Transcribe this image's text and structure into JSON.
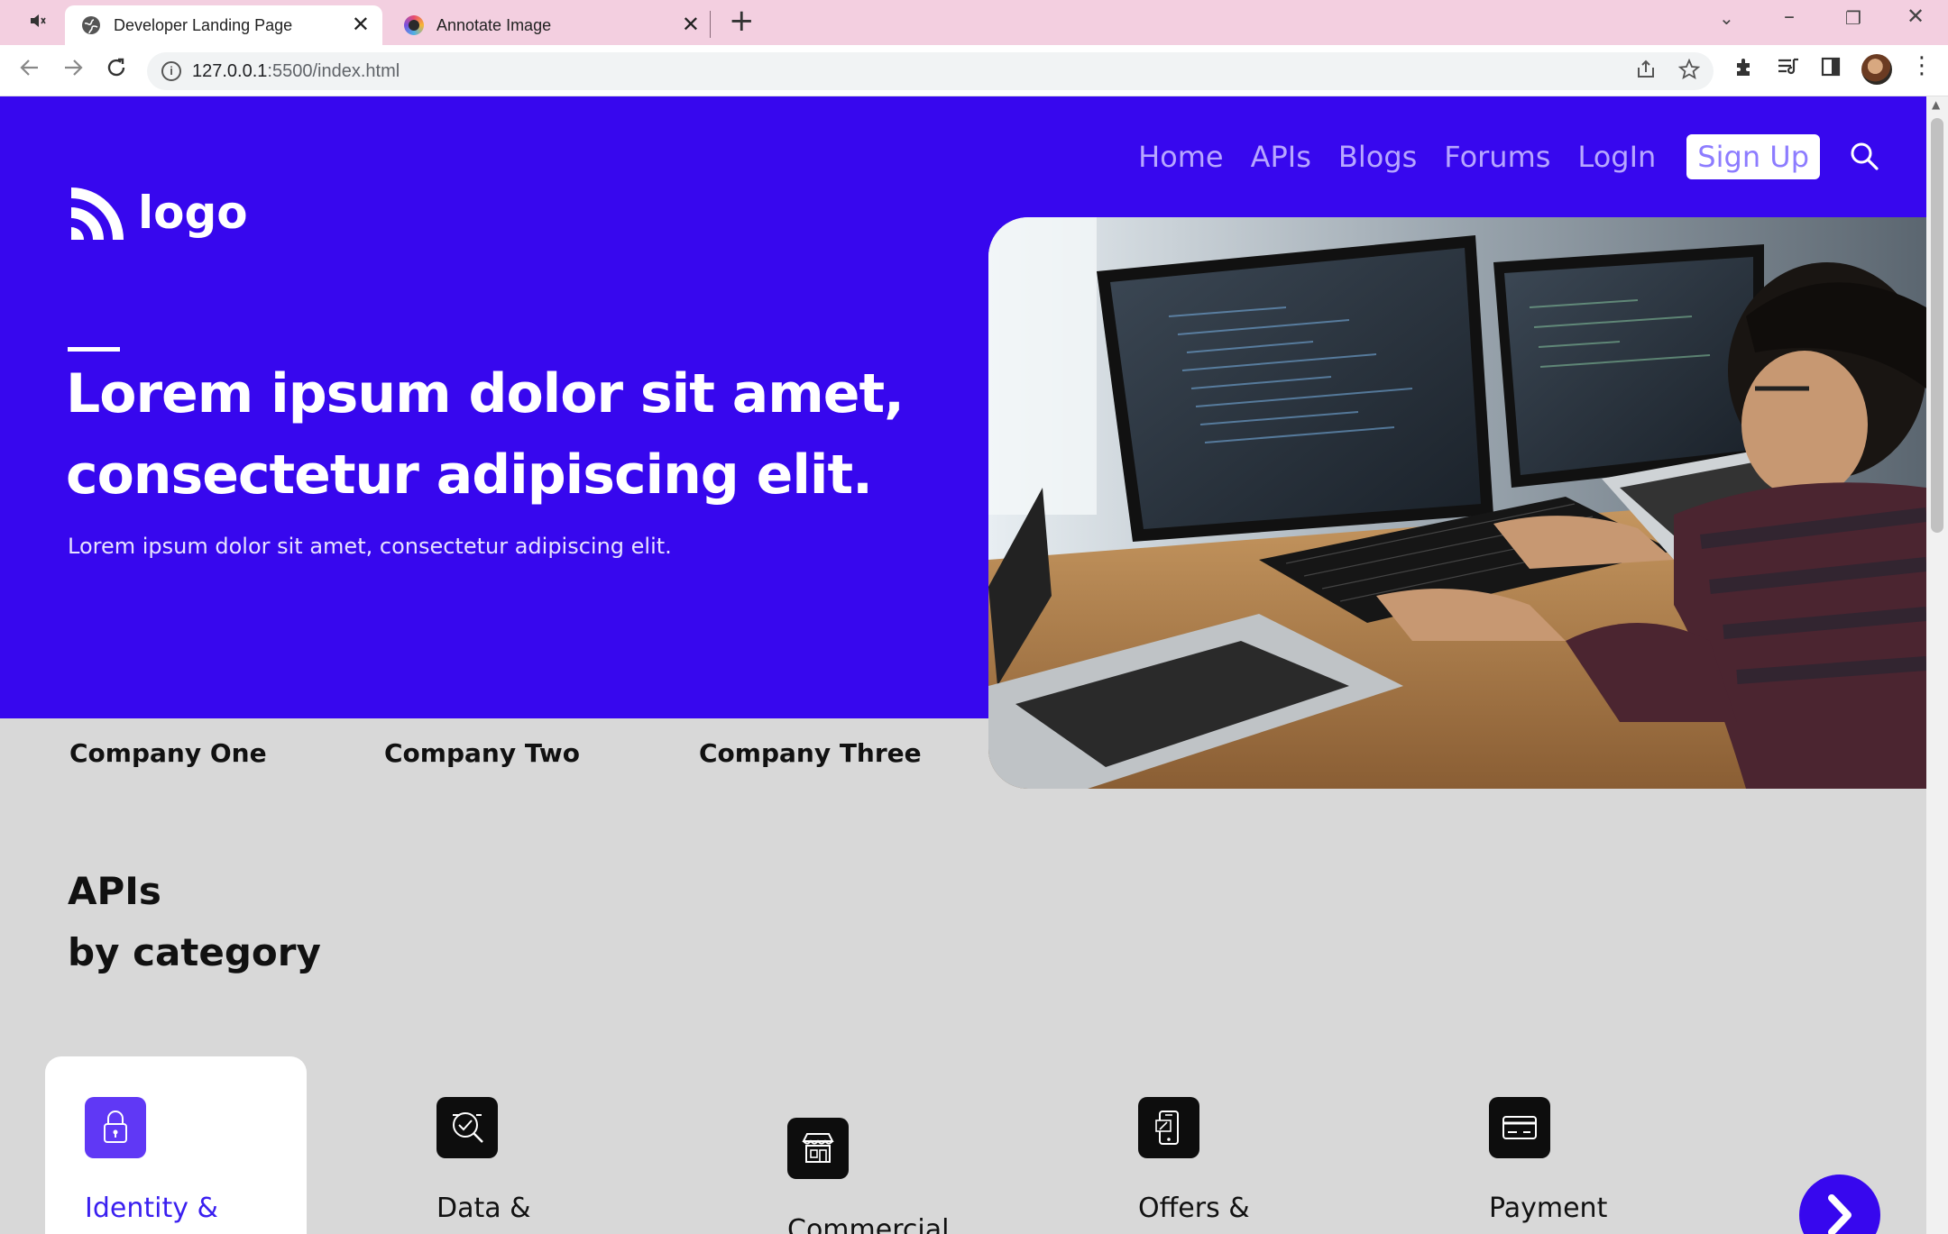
{
  "browser": {
    "tabs": [
      {
        "title": "Developer Landing Page",
        "active": true
      },
      {
        "title": "Annotate Image",
        "active": false
      }
    ],
    "new_tab_symbol": "+",
    "close_symbol": "✕",
    "url_host": "127.0.0.1",
    "url_path": ":5500/index.html",
    "info_symbol": "i"
  },
  "nav": {
    "items": [
      "Home",
      "APIs",
      "Blogs",
      "Forums",
      "LogIn"
    ],
    "signup": "Sign Up",
    "search_icon": "search-icon"
  },
  "logo": {
    "text": "logo"
  },
  "hero": {
    "title": "Lorem ipsum dolor sit amet, consectetur adipiscing elit.",
    "subtitle": "Lorem ipsum dolor sit amet, consectetur adipiscing elit."
  },
  "companies": [
    "Company One",
    "Company Two",
    "Company Three"
  ],
  "apis": {
    "title_line1": "APIs",
    "title_line2": "by category",
    "categories": [
      {
        "label": "Identity &",
        "icon": "lock-icon",
        "active": true
      },
      {
        "label": "Data &",
        "icon": "magnifier-check-icon",
        "active": false
      },
      {
        "label": "Commercial",
        "icon": "storefront-icon",
        "active": false
      },
      {
        "label": "Offers &",
        "icon": "phone-coupon-icon",
        "active": false
      },
      {
        "label": "Payment",
        "icon": "card-icon",
        "active": false
      }
    ]
  },
  "colors": {
    "hero_bg": "#3707ee",
    "nav_text": "#b7a6ff",
    "active_icon": "#6038f5"
  }
}
